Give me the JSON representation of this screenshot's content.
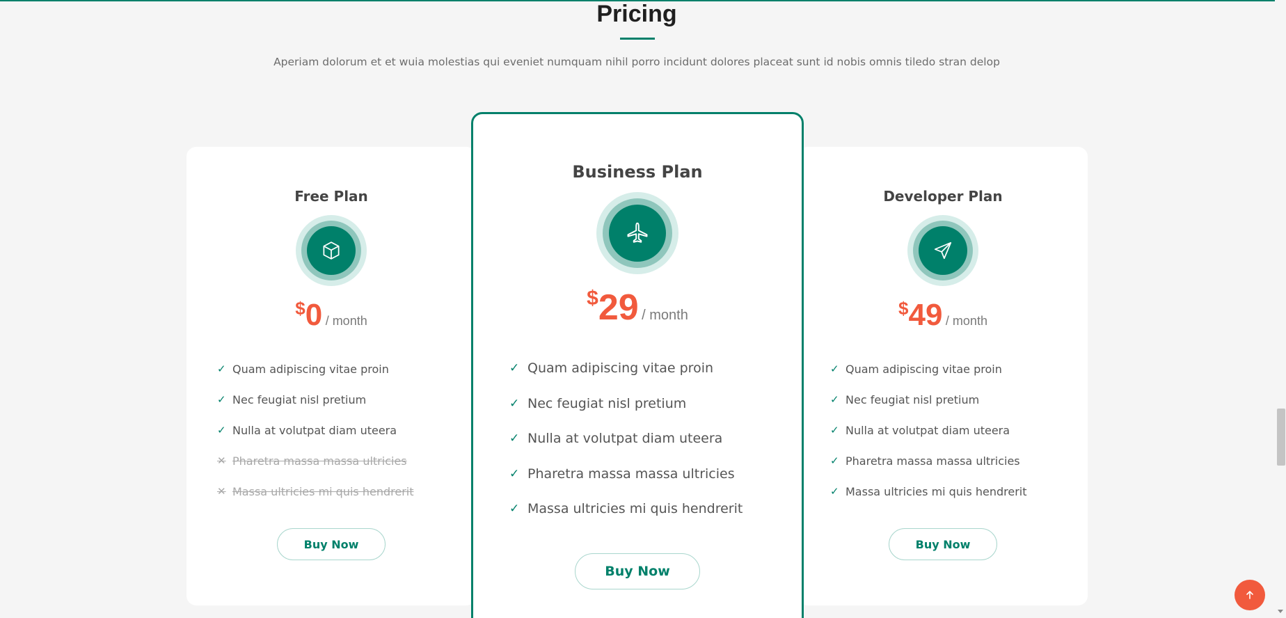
{
  "section": {
    "title": "Pricing",
    "description": "Aperiam dolorum et et wuia molestias qui eveniet numquam nihil porro incidunt dolores placeat sunt id nobis omnis tiledo stran delop"
  },
  "plans": [
    {
      "name": "Free Plan",
      "icon": "box-icon",
      "currency": "$",
      "price": "0",
      "period": "/ month",
      "features": [
        {
          "text": "Quam adipiscing vitae proin",
          "included": true
        },
        {
          "text": "Nec feugiat nisl pretium",
          "included": true
        },
        {
          "text": "Nulla at volutpat diam uteera",
          "included": true
        },
        {
          "text": "Pharetra massa massa ultricies",
          "included": false
        },
        {
          "text": "Massa ultricies mi quis hendrerit",
          "included": false
        }
      ],
      "button": "Buy Now"
    },
    {
      "name": "Business Plan",
      "icon": "airplane-icon",
      "featured": true,
      "currency": "$",
      "price": "29",
      "period": "/ month",
      "features": [
        {
          "text": "Quam adipiscing vitae proin",
          "included": true
        },
        {
          "text": "Nec feugiat nisl pretium",
          "included": true
        },
        {
          "text": "Nulla at volutpat diam uteera",
          "included": true
        },
        {
          "text": "Pharetra massa massa ultricies",
          "included": true
        },
        {
          "text": "Massa ultricies mi quis hendrerit",
          "included": true
        }
      ],
      "button": "Buy Now"
    },
    {
      "name": "Developer Plan",
      "icon": "send-icon",
      "currency": "$",
      "price": "49",
      "period": "/ month",
      "features": [
        {
          "text": "Quam adipiscing vitae proin",
          "included": true
        },
        {
          "text": "Nec feugiat nisl pretium",
          "included": true
        },
        {
          "text": "Nulla at volutpat diam uteera",
          "included": true
        },
        {
          "text": "Pharetra massa massa ultricies",
          "included": true
        },
        {
          "text": "Massa ultricies mi quis hendrerit",
          "included": true
        }
      ],
      "button": "Buy Now"
    }
  ],
  "marks": {
    "included": "✓",
    "excluded": "✕"
  },
  "back_to_top": {
    "icon": "arrow-up-icon"
  },
  "colors": {
    "accent": "#00806a",
    "price": "#f15a3d",
    "background": "#f5f5f5"
  }
}
